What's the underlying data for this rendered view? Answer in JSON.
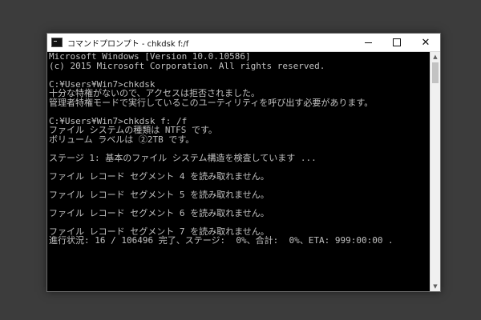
{
  "window": {
    "title": "コマンドプロンプト - chkdsk  f:/f",
    "icon": "cmd-icon",
    "controls": {
      "minimize": "minimize-icon",
      "maximize": "maximize-icon",
      "close": "close-icon"
    }
  },
  "console": {
    "lines": [
      "Microsoft Windows [Version 10.0.10586]",
      "(c) 2015 Microsoft Corporation. All rights reserved.",
      "",
      "C:¥Users¥Win7>chkdsk",
      "十分な特権がないので、アクセスは拒否されました。",
      "管理者特権モードで実行しているこのユーティリティを呼び出す必要があります。",
      "",
      "C:¥Users¥Win7>chkdsk f: /f",
      "ファイル システムの種類は NTFS です。",
      "ボリューム ラベルは ②2TB です。",
      "",
      "ステージ 1: 基本のファイル システム構造を検査しています ...",
      "",
      "ファイル レコード セグメント 4 を読み取れません。",
      "",
      "ファイル レコード セグメント 5 を読み取れません。",
      "",
      "ファイル レコード セグメント 6 を読み取れません。",
      "",
      "ファイル レコード セグメント 7 を読み取れません。",
      "進行状況: 16 / 106496 完了、ステージ:  0%、合計:  0%、ETA: 999:00:00 ."
    ]
  },
  "colors": {
    "console_bg": "#000000",
    "console_fg": "#c0c0c0",
    "titlebar_bg": "#ffffff"
  }
}
